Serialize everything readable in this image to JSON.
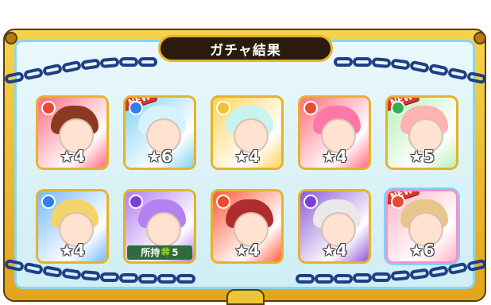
{
  "title": "ガチャ結果",
  "results": [
    {
      "stars": "★4",
      "new": false,
      "owned": "",
      "element": "fire",
      "hair": "#8b3a22",
      "bg": "#ff6b7e"
    },
    {
      "stars": "★6",
      "new": true,
      "owned": "",
      "element": "water",
      "hair": "#d7f2ff",
      "bg": "#7fd2f0"
    },
    {
      "stars": "★4",
      "new": false,
      "owned": "",
      "element": "light",
      "hair": "#c9f3ef",
      "bg": "#ffd35c"
    },
    {
      "stars": "★4",
      "new": false,
      "owned": "",
      "element": "fire",
      "hair": "#ff76a9",
      "bg": "#ff6d7d"
    },
    {
      "stars": "★5",
      "new": true,
      "owned": "",
      "element": "wood",
      "hair": "#ffb2b2",
      "bg": "#b7f0b4"
    },
    {
      "stars": "★4",
      "new": false,
      "owned": "",
      "element": "water",
      "hair": "#f2d46b",
      "bg": "#76b8ff"
    },
    {
      "stars": "",
      "new": false,
      "owned": "所持🍀5",
      "element": "dark",
      "hair": "#b481f0",
      "bg": "#b17ef0"
    },
    {
      "stars": "★4",
      "new": false,
      "owned": "",
      "element": "fire",
      "hair": "#b02d2d",
      "bg": "#ff5b3a"
    },
    {
      "stars": "★4",
      "new": false,
      "owned": "",
      "element": "dark",
      "hair": "#e9e9e9",
      "bg": "#8c5ad9"
    },
    {
      "stars": "★6",
      "new": true,
      "owned": "",
      "element": "fire",
      "hair": "#e8c58a",
      "bg": "#ffb3c3"
    }
  ],
  "new_label": "NEW",
  "colors": {
    "fire": "#e94b2f",
    "water": "#2f80e9",
    "wood": "#2fb34d",
    "light": "#f2c12e",
    "dark": "#7a3fd6"
  }
}
